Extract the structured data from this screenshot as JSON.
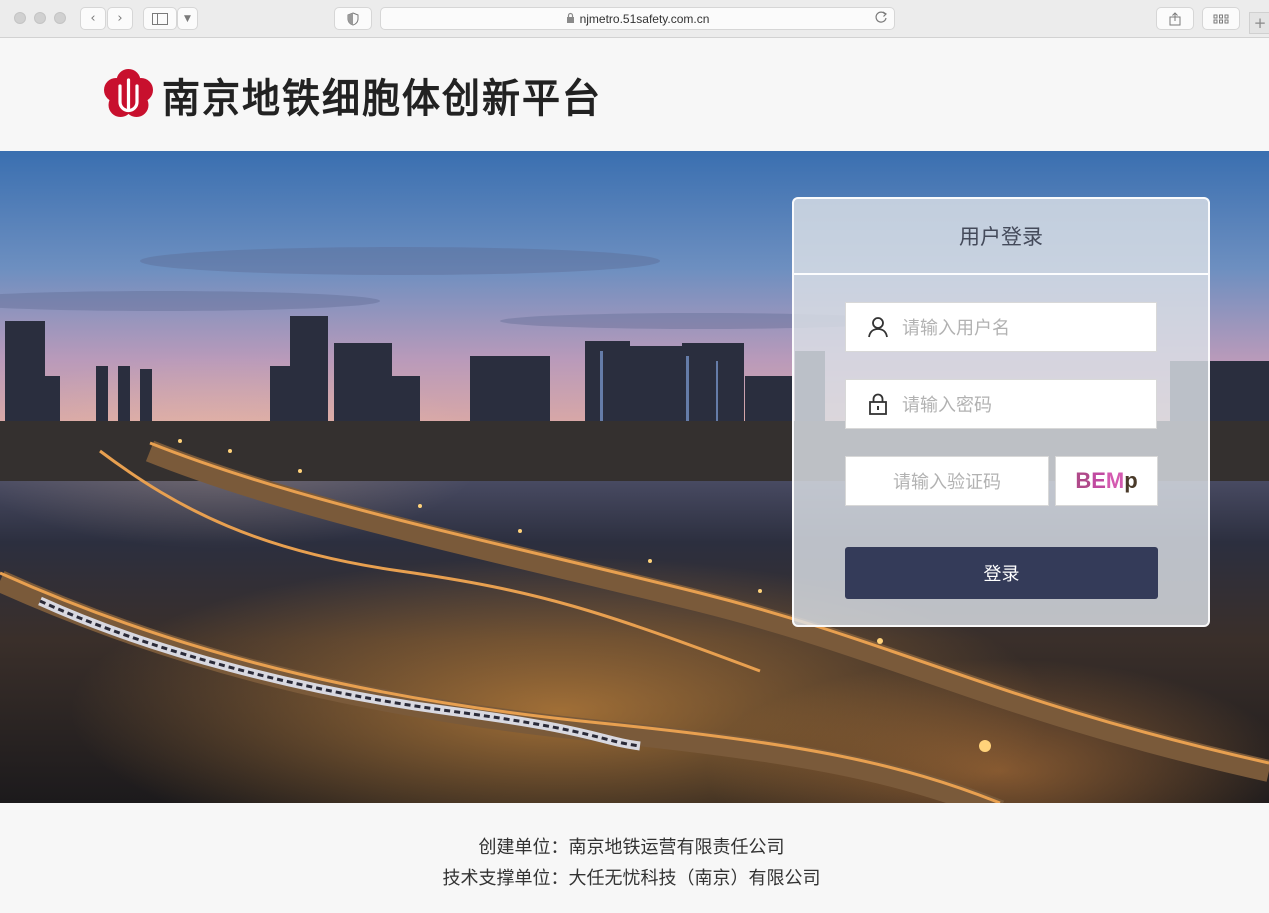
{
  "browser": {
    "url": "njmetro.51safety.com.cn",
    "new_tab": "+"
  },
  "header": {
    "brand_title": "南京地铁细胞体创新平台"
  },
  "login": {
    "title": "用户登录",
    "username_placeholder": "请输入用户名",
    "password_placeholder": "请输入密码",
    "captcha_placeholder": "请输入验证码",
    "captcha_chars": [
      "B",
      "E",
      "M",
      "p"
    ],
    "captcha_colors": [
      "#b04a8a",
      "#c04aa0",
      "#d45ab0",
      "#4a3a2a"
    ],
    "submit_label": "登录",
    "button_color": "#343b59"
  },
  "footer": {
    "creator": "创建单位：南京地铁运营有限责任公司",
    "tech_support": "技术支撑单位：大任无忧科技（南京）有限公司"
  },
  "colors": {
    "brand_red": "#c8102e"
  }
}
